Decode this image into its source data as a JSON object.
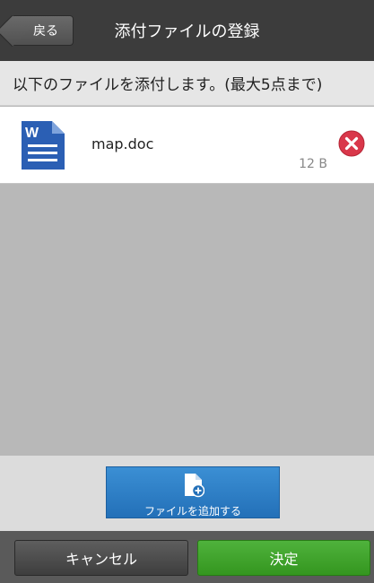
{
  "header": {
    "back_label": "戻る",
    "title": "添付ファイルの登録"
  },
  "instruction": "以下のファイルを添付します。(最大5点まで)",
  "files": [
    {
      "name": "map.doc",
      "size": "12 B",
      "icon": "word-document-icon"
    }
  ],
  "add_button": {
    "label": "ファイルを追加する",
    "icon": "add-file-icon"
  },
  "footer": {
    "cancel_label": "キャンセル",
    "ok_label": "決定"
  },
  "colors": {
    "header_bg": "#3c3c3c",
    "add_button": "#2f80c8",
    "ok_button": "#3fa52a",
    "remove_icon": "#d9374a",
    "word_icon": "#2b5fb4"
  }
}
